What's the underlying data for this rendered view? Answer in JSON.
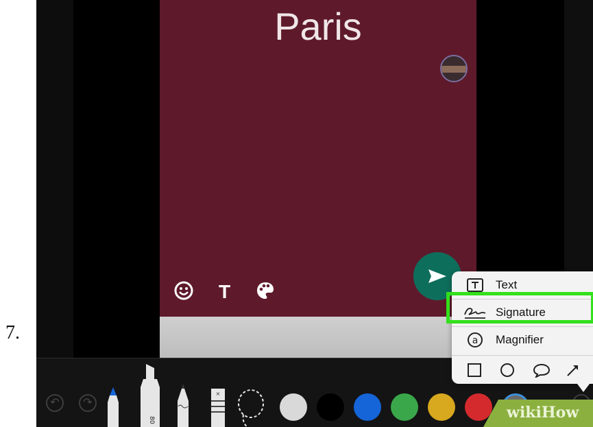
{
  "step": {
    "number": "7."
  },
  "story": {
    "title": "Paris",
    "background_color": "#5e1a2b",
    "tools": [
      {
        "name": "emoji",
        "icon": "smiley-icon",
        "glyph": "☺"
      },
      {
        "name": "text",
        "icon": "text-tool-icon",
        "glyph": "T"
      },
      {
        "name": "color",
        "icon": "palette-icon",
        "glyph": "🎨"
      }
    ]
  },
  "send": {
    "icon": "send-arrow-icon",
    "color": "#0e6e5c"
  },
  "markup_menu": {
    "items": [
      {
        "label": "Text",
        "icon": "text-box-icon"
      },
      {
        "label": "Signature",
        "icon": "signature-icon",
        "highlighted": true
      },
      {
        "label": "Magnifier",
        "icon": "magnifier-icon"
      }
    ],
    "shapes": [
      "square-shape-icon",
      "circle-shape-icon",
      "speech-bubble-icon",
      "arrow-shape-icon"
    ],
    "highlight_color": "#33e01c"
  },
  "toolbar": {
    "undo_icon": "undo-icon",
    "redo_icon": "redo-icon",
    "tools": [
      "pen-tool-icon",
      "marker-tool-icon",
      "pencil-tool-icon",
      "eraser-tool-icon",
      "lasso-tool-icon"
    ],
    "marker_label": "80",
    "colors": [
      "#d9d9d9",
      "#000000",
      "#1565d8",
      "#3aa84a",
      "#d8a81f",
      "#d42a2e"
    ]
  },
  "watermark": {
    "text": "wikiHow",
    "color": "#8cb03f"
  }
}
